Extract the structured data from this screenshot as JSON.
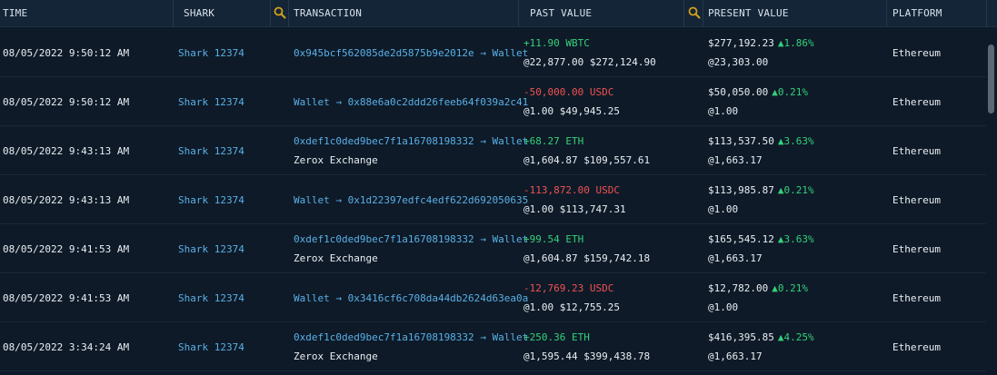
{
  "header": {
    "time": "TIME",
    "shark": "SHARK",
    "transaction": "TRANSACTION",
    "past_value": "PAST VALUE",
    "present_value": "PRESENT VALUE",
    "platform": "PLATFORM"
  },
  "colors": {
    "positive": "#34d17a",
    "negative": "#f05252",
    "link": "#5ab0e6",
    "search_icon": "#d4a21a"
  },
  "rows": [
    {
      "time": "08/05/2022 9:50:12 AM",
      "shark": "Shark 12374",
      "tx": "0x945bcf562085de2d5875b9e2012e → Wallet",
      "tx_sub": "",
      "past_amount": "+11.90 WBTC",
      "past_dir": "pos",
      "past_value": "@22,877.00 $272,124.90",
      "present_amount": "$277,192.23",
      "present_change": "▲1.86%",
      "present_price": "@23,303.00",
      "platform": "Ethereum"
    },
    {
      "time": "08/05/2022 9:50:12 AM",
      "shark": "Shark 12374",
      "tx": "Wallet → 0x88e6a0c2ddd26feeb64f039a2c41",
      "tx_sub": "",
      "past_amount": "-50,000.00 USDC",
      "past_dir": "neg",
      "past_value": "@1.00 $49,945.25",
      "present_amount": "$50,050.00",
      "present_change": "▲0.21%",
      "present_price": "@1.00",
      "platform": "Ethereum"
    },
    {
      "time": "08/05/2022 9:43:13 AM",
      "shark": "Shark 12374",
      "tx": "0xdef1c0ded9bec7f1a16708198332 → Wallet",
      "tx_sub": "Zerox Exchange",
      "past_amount": "+68.27 ETH",
      "past_dir": "pos",
      "past_value": "@1,604.87 $109,557.61",
      "present_amount": "$113,537.50",
      "present_change": "▲3.63%",
      "present_price": "@1,663.17",
      "platform": "Ethereum"
    },
    {
      "time": "08/05/2022 9:43:13 AM",
      "shark": "Shark 12374",
      "tx": "Wallet → 0x1d22397edfc4edf622d692050635",
      "tx_sub": "",
      "past_amount": "-113,872.00 USDC",
      "past_dir": "neg",
      "past_value": "@1.00 $113,747.31",
      "present_amount": "$113,985.87",
      "present_change": "▲0.21%",
      "present_price": "@1.00",
      "platform": "Ethereum"
    },
    {
      "time": "08/05/2022 9:41:53 AM",
      "shark": "Shark 12374",
      "tx": "0xdef1c0ded9bec7f1a16708198332 → Wallet",
      "tx_sub": "Zerox Exchange",
      "past_amount": "+99.54 ETH",
      "past_dir": "pos",
      "past_value": "@1,604.87 $159,742.18",
      "present_amount": "$165,545.12",
      "present_change": "▲3.63%",
      "present_price": "@1,663.17",
      "platform": "Ethereum"
    },
    {
      "time": "08/05/2022 9:41:53 AM",
      "shark": "Shark 12374",
      "tx": "Wallet → 0x3416cf6c708da44db2624d63ea0a",
      "tx_sub": "",
      "past_amount": "-12,769.23 USDC",
      "past_dir": "neg",
      "past_value": "@1.00 $12,755.25",
      "present_amount": "$12,782.00",
      "present_change": "▲0.21%",
      "present_price": "@1.00",
      "platform": "Ethereum"
    },
    {
      "time": "08/05/2022 3:34:24 AM",
      "shark": "Shark 12374",
      "tx": "0xdef1c0ded9bec7f1a16708198332 → Wallet",
      "tx_sub": "Zerox Exchange",
      "past_amount": "+250.36 ETH",
      "past_dir": "pos",
      "past_value": "@1,595.44 $399,438.78",
      "present_amount": "$416,395.85",
      "present_change": "▲4.25%",
      "present_price": "@1,663.17",
      "platform": "Ethereum"
    }
  ]
}
